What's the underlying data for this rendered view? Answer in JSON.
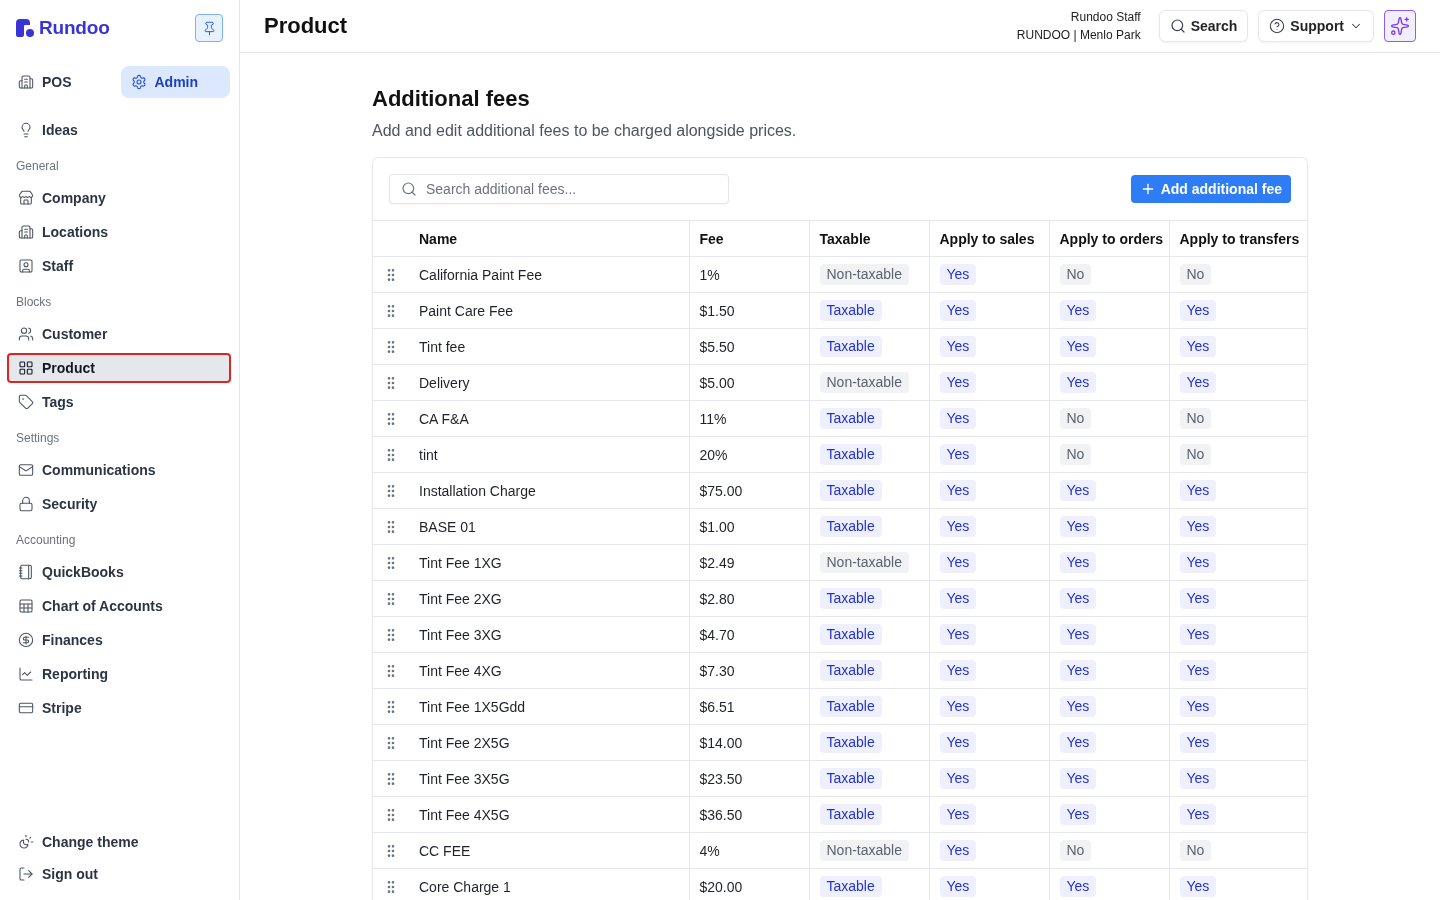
{
  "sidebar": {
    "logo": "Rundoo",
    "modes": [
      {
        "label": "POS",
        "selected": false
      },
      {
        "label": "Admin",
        "selected": true
      }
    ],
    "items": [
      {
        "label": "Ideas",
        "selected": false
      }
    ],
    "sections": [
      {
        "title": "General",
        "items": [
          {
            "label": "Company",
            "selected": false
          },
          {
            "label": "Locations",
            "selected": false
          },
          {
            "label": "Staff",
            "selected": false
          }
        ]
      },
      {
        "title": "Blocks",
        "items": [
          {
            "label": "Customer",
            "selected": false
          },
          {
            "label": "Product",
            "selected": true
          },
          {
            "label": "Tags",
            "selected": false
          }
        ]
      },
      {
        "title": "Settings",
        "items": [
          {
            "label": "Communications",
            "selected": false
          },
          {
            "label": "Security",
            "selected": false
          }
        ]
      },
      {
        "title": "Accounting",
        "items": [
          {
            "label": "QuickBooks",
            "selected": false
          },
          {
            "label": "Chart of Accounts",
            "selected": false
          },
          {
            "label": "Finances",
            "selected": false
          },
          {
            "label": "Reporting",
            "selected": false
          },
          {
            "label": "Stripe",
            "selected": false
          }
        ]
      }
    ],
    "footer_items": [
      {
        "label": "Change theme"
      },
      {
        "label": "Sign out"
      }
    ]
  },
  "header": {
    "title": "Product",
    "user": {
      "name": "Rundoo Staff",
      "location": "RUNDOO | Menlo Park"
    },
    "search_button": "Search",
    "support_button": "Support"
  },
  "page": {
    "title": "Additional fees",
    "subtitle": "Add and edit additional fees to be charged alongside prices.",
    "search": {
      "placeholder": "Search additional fees..."
    },
    "add_button": "Add additional fee"
  },
  "table": {
    "columns": [
      "Name",
      "Fee",
      "Taxable",
      "Apply to sales",
      "Apply to orders",
      "Apply to transfers"
    ],
    "rows": [
      {
        "name": "California Paint Fee",
        "fee": "1%",
        "flags": [
          {
            "text": "Non-taxable",
            "on": false
          },
          {
            "text": "Yes",
            "on": true
          },
          {
            "text": "No",
            "on": false
          },
          {
            "text": "No",
            "on": false
          }
        ]
      },
      {
        "name": "Paint Care Fee",
        "fee": "$1.50",
        "flags": [
          {
            "text": "Taxable",
            "on": true
          },
          {
            "text": "Yes",
            "on": true
          },
          {
            "text": "Yes",
            "on": true
          },
          {
            "text": "Yes",
            "on": true
          }
        ]
      },
      {
        "name": "Tint fee",
        "fee": "$5.50",
        "flags": [
          {
            "text": "Taxable",
            "on": true
          },
          {
            "text": "Yes",
            "on": true
          },
          {
            "text": "Yes",
            "on": true
          },
          {
            "text": "Yes",
            "on": true
          }
        ]
      },
      {
        "name": "Delivery",
        "fee": "$5.00",
        "flags": [
          {
            "text": "Non-taxable",
            "on": false
          },
          {
            "text": "Yes",
            "on": true
          },
          {
            "text": "Yes",
            "on": true
          },
          {
            "text": "Yes",
            "on": true
          }
        ]
      },
      {
        "name": "CA F&A",
        "fee": "11%",
        "flags": [
          {
            "text": "Taxable",
            "on": true
          },
          {
            "text": "Yes",
            "on": true
          },
          {
            "text": "No",
            "on": false
          },
          {
            "text": "No",
            "on": false
          }
        ]
      },
      {
        "name": "tint",
        "fee": "20%",
        "flags": [
          {
            "text": "Taxable",
            "on": true
          },
          {
            "text": "Yes",
            "on": true
          },
          {
            "text": "No",
            "on": false
          },
          {
            "text": "No",
            "on": false
          }
        ]
      },
      {
        "name": "Installation Charge",
        "fee": "$75.00",
        "flags": [
          {
            "text": "Taxable",
            "on": true
          },
          {
            "text": "Yes",
            "on": true
          },
          {
            "text": "Yes",
            "on": true
          },
          {
            "text": "Yes",
            "on": true
          }
        ]
      },
      {
        "name": "BASE 01",
        "fee": "$1.00",
        "flags": [
          {
            "text": "Taxable",
            "on": true
          },
          {
            "text": "Yes",
            "on": true
          },
          {
            "text": "Yes",
            "on": true
          },
          {
            "text": "Yes",
            "on": true
          }
        ]
      },
      {
        "name": "Tint Fee 1XG",
        "fee": "$2.49",
        "flags": [
          {
            "text": "Non-taxable",
            "on": false
          },
          {
            "text": "Yes",
            "on": true
          },
          {
            "text": "Yes",
            "on": true
          },
          {
            "text": "Yes",
            "on": true
          }
        ]
      },
      {
        "name": "Tint Fee 2XG",
        "fee": "$2.80",
        "flags": [
          {
            "text": "Taxable",
            "on": true
          },
          {
            "text": "Yes",
            "on": true
          },
          {
            "text": "Yes",
            "on": true
          },
          {
            "text": "Yes",
            "on": true
          }
        ]
      },
      {
        "name": "Tint Fee 3XG",
        "fee": "$4.70",
        "flags": [
          {
            "text": "Taxable",
            "on": true
          },
          {
            "text": "Yes",
            "on": true
          },
          {
            "text": "Yes",
            "on": true
          },
          {
            "text": "Yes",
            "on": true
          }
        ]
      },
      {
        "name": "Tint Fee 4XG",
        "fee": "$7.30",
        "flags": [
          {
            "text": "Taxable",
            "on": true
          },
          {
            "text": "Yes",
            "on": true
          },
          {
            "text": "Yes",
            "on": true
          },
          {
            "text": "Yes",
            "on": true
          }
        ]
      },
      {
        "name": "Tint Fee 1X5Gdd",
        "fee": "$6.51",
        "flags": [
          {
            "text": "Taxable",
            "on": true
          },
          {
            "text": "Yes",
            "on": true
          },
          {
            "text": "Yes",
            "on": true
          },
          {
            "text": "Yes",
            "on": true
          }
        ]
      },
      {
        "name": "Tint Fee 2X5G",
        "fee": "$14.00",
        "flags": [
          {
            "text": "Taxable",
            "on": true
          },
          {
            "text": "Yes",
            "on": true
          },
          {
            "text": "Yes",
            "on": true
          },
          {
            "text": "Yes",
            "on": true
          }
        ]
      },
      {
        "name": "Tint Fee 3X5G",
        "fee": "$23.50",
        "flags": [
          {
            "text": "Taxable",
            "on": true
          },
          {
            "text": "Yes",
            "on": true
          },
          {
            "text": "Yes",
            "on": true
          },
          {
            "text": "Yes",
            "on": true
          }
        ]
      },
      {
        "name": "Tint Fee 4X5G",
        "fee": "$36.50",
        "flags": [
          {
            "text": "Taxable",
            "on": true
          },
          {
            "text": "Yes",
            "on": true
          },
          {
            "text": "Yes",
            "on": true
          },
          {
            "text": "Yes",
            "on": true
          }
        ]
      },
      {
        "name": "CC FEE",
        "fee": "4%",
        "flags": [
          {
            "text": "Non-taxable",
            "on": false
          },
          {
            "text": "Yes",
            "on": true
          },
          {
            "text": "No",
            "on": false
          },
          {
            "text": "No",
            "on": false
          }
        ]
      },
      {
        "name": "Core Charge 1",
        "fee": "$20.00",
        "flags": [
          {
            "text": "Taxable",
            "on": true
          },
          {
            "text": "Yes",
            "on": true
          },
          {
            "text": "Yes",
            "on": true
          },
          {
            "text": "Yes",
            "on": true
          }
        ]
      }
    ]
  }
}
